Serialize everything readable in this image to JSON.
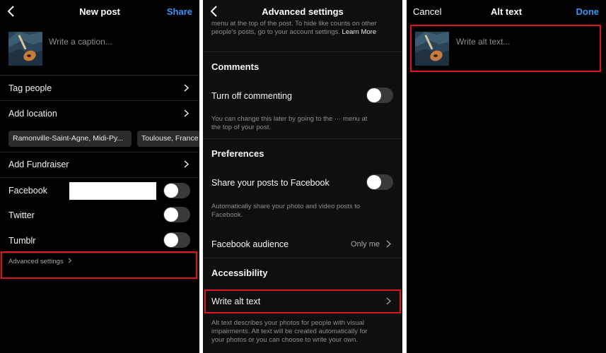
{
  "new_post": {
    "title": "New post",
    "share_label": "Share",
    "caption_placeholder": "Write a caption...",
    "tag_people": "Tag people",
    "add_location": "Add location",
    "location_chips": [
      "Ramonville-Saint-Agne, Midi-Py...",
      "Toulouse, France"
    ],
    "add_fundraiser": "Add Fundraiser",
    "facebook": "Facebook",
    "twitter": "Twitter",
    "tumblr": "Tumblr",
    "advanced_settings": "Advanced settings"
  },
  "advanced_settings": {
    "title": "Advanced settings",
    "top_text_line1": "menu at the top of the post. To hide like counts on other",
    "top_text_line2": "people's posts, go to your account settings.",
    "learn_more": "Learn More",
    "comments_header": "Comments",
    "turn_off_commenting": "Turn off commenting",
    "commenting_help_line1": "You can change this later by going to the ··· menu at",
    "commenting_help_line2": "the top of your post.",
    "preferences_header": "Preferences",
    "share_to_facebook": "Share your posts to Facebook",
    "share_help_line1": "Automatically share your photo and video posts to",
    "share_help_line2": "Facebook.",
    "facebook_audience": "Facebook audience",
    "facebook_audience_value": "Only me",
    "accessibility_header": "Accessibility",
    "write_alt_text": "Write alt text",
    "alt_help_line1": "Alt text describes your photos for people with visual",
    "alt_help_line2": "impairments. Alt text will be created automatically for",
    "alt_help_line3": "your photos or you can choose to write your own."
  },
  "alt_text": {
    "cancel": "Cancel",
    "title": "Alt text",
    "done": "Done",
    "placeholder": "Write alt text..."
  },
  "colors": {
    "accent_blue": "#3b95f2",
    "highlight_red": "#e0141e",
    "background": "#000000"
  }
}
